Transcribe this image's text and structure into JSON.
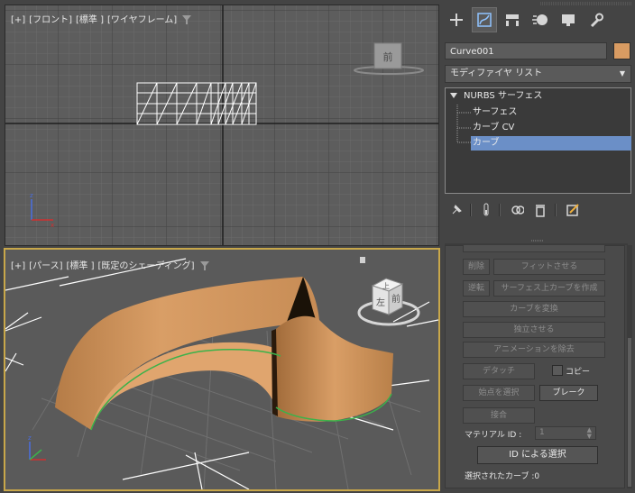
{
  "viewport_top": {
    "label_plus": "[+]",
    "label_view": "[フロント]",
    "label_quality": "[標準 ]",
    "label_shading": "[ワイヤフレーム]",
    "viewcube_face": "前"
  },
  "viewport_bottom": {
    "label_plus": "[+]",
    "label_view": "[パース]",
    "label_quality": "[標準 ]",
    "label_shading": "[既定のシェーディング]",
    "viewcube_top": "上",
    "viewcube_front": "前",
    "viewcube_left": "左"
  },
  "command_panel": {
    "tabs": [
      "create-icon",
      "modify-icon",
      "hierarchy-icon",
      "motion-icon",
      "display-icon",
      "utilities-icon"
    ],
    "object_name": "Curve001",
    "object_color": "#d89b62",
    "modifier_list": "モディファイヤ リスト",
    "stack": {
      "root": "NURBS サーフェス",
      "items": [
        "サーフェス",
        "カーブ CV",
        "カーブ"
      ],
      "selected_index": 2
    },
    "rollout": {
      "delete": "削除",
      "fit": "フィットさせる",
      "reverse": "逆転",
      "make_surface_curve": "サーフェス上カーブを作成",
      "convert_curve": "カーブを変換",
      "make_independent": "独立させる",
      "remove_animation": "アニメーションを除去",
      "detach": "デタッチ",
      "copy_label": "コピー",
      "select_first_vertex": "始点を選択",
      "break": "ブレーク",
      "join": "接合",
      "material_id_label": "マテリアル ID :",
      "material_id_value": "1",
      "select_by_id": "ID による選択",
      "selected_curves": "選択されたカーブ :0"
    }
  },
  "colors": {
    "viewport_bg": "#5d5d5d",
    "active_border": "#c8a74a",
    "surface": "#d89b62",
    "selection": "#6b8fc7"
  }
}
